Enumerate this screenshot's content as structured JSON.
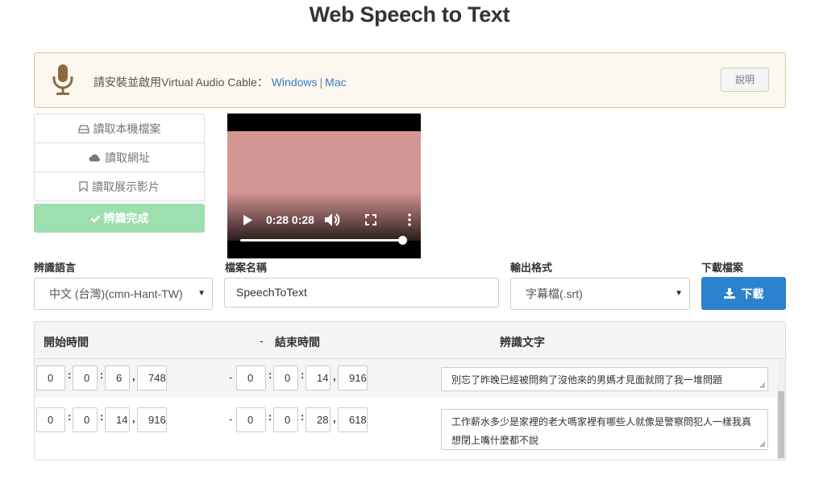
{
  "page": {
    "title": "Web Speech to Text"
  },
  "notice": {
    "message": "請安裝並啟用Virtual Audio Cable：",
    "link_windows": "Windows",
    "separator": "|",
    "link_mac": "Mac",
    "help_button": "說明",
    "icon": "microphone-icon",
    "background_color": "#fcf8f0",
    "border_color": "#d9c39c"
  },
  "sources": {
    "items": [
      {
        "label": "讀取本機檔案",
        "icon": "hdd-icon"
      },
      {
        "label": "讀取網址",
        "icon": "cloud-icon"
      },
      {
        "label": "讀取展示影片",
        "icon": "bookmark-icon"
      }
    ],
    "status_button": {
      "label": "辨識完成",
      "icon": "check-icon",
      "color": "#9ddfae"
    }
  },
  "video": {
    "time_label": "0:28 0:28",
    "progress": 1.0,
    "icons": [
      "play-icon",
      "volume-icon",
      "fullscreen-icon",
      "more-vert-icon"
    ]
  },
  "settings": {
    "language": {
      "label": "辨識語言",
      "value": "中文 (台灣)(cmn-Hant-TW)"
    },
    "filename": {
      "label": "檔案名稱",
      "value": "SpeechToText"
    },
    "format": {
      "label": "輸出格式",
      "value": "字幕檔(.srt)"
    },
    "download": {
      "label": "下載檔案",
      "button": "下載",
      "icon": "download-icon",
      "color": "#2b83cf"
    }
  },
  "table": {
    "headers": {
      "start": "開始時間",
      "separator": "-",
      "end": "結束時間",
      "text": "辨識文字"
    },
    "rows": [
      {
        "start": [
          "0",
          "0",
          "6",
          "748"
        ],
        "end": [
          "0",
          "0",
          "14",
          "916"
        ],
        "text": "別忘了昨晚已經被問夠了沒他來的男媽才見面就問了我一堆問題"
      },
      {
        "start": [
          "0",
          "0",
          "14",
          "916"
        ],
        "end": [
          "0",
          "0",
          "28",
          "618"
        ],
        "text": "工作薪水多少是家裡的老大嗎家裡有哪些人就像是警察問犯人一樣我真想閉上嘴什麼都不說"
      }
    ],
    "time_colon": ":",
    "ms_comma": ","
  }
}
